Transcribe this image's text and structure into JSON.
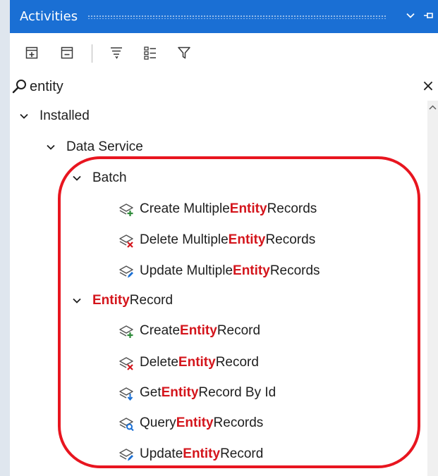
{
  "panel": {
    "title": "Activities",
    "accent": "#1a6fd4",
    "title_icons": [
      "chevron-down-icon",
      "pin-icon"
    ]
  },
  "toolbar": {
    "buttons": [
      "expand-all-icon",
      "collapse-all-icon",
      "sort-icon",
      "list-view-icon",
      "filter-icon"
    ]
  },
  "search": {
    "value": "entity",
    "clear_label": "×"
  },
  "tree": {
    "installed_label": "Installed",
    "data_service_label": "Data Service",
    "batch_label": "Batch",
    "batch_items": [
      {
        "pre": "Create Multiple ",
        "hl": "Entity",
        "post": " Records",
        "icon": "create-entity-icon"
      },
      {
        "pre": "Delete Multiple ",
        "hl": "Entity",
        "post": " Records",
        "icon": "delete-entity-icon"
      },
      {
        "pre": "Update Multiple ",
        "hl": "Entity",
        "post": " Records",
        "icon": "update-entity-icon"
      }
    ],
    "entity_record_label": {
      "hl": "Entity",
      "post": "Record"
    },
    "entity_record_items": [
      {
        "pre": "Create ",
        "hl": "Entity",
        "post": " Record",
        "icon": "create-entity-icon"
      },
      {
        "pre": "Delete ",
        "hl": "Entity",
        "post": " Record",
        "icon": "delete-entity-icon"
      },
      {
        "pre": "Get ",
        "hl": "Entity",
        "post": " Record By Id",
        "icon": "get-entity-icon"
      },
      {
        "pre": "Query ",
        "hl": "Entity",
        "post": " Records",
        "icon": "query-entity-icon"
      },
      {
        "pre": "Update ",
        "hl": "Entity",
        "post": " Record",
        "icon": "update-entity-icon"
      }
    ],
    "highlight_color": "#d4151c"
  },
  "annotation": {
    "color": "#e8151f"
  }
}
